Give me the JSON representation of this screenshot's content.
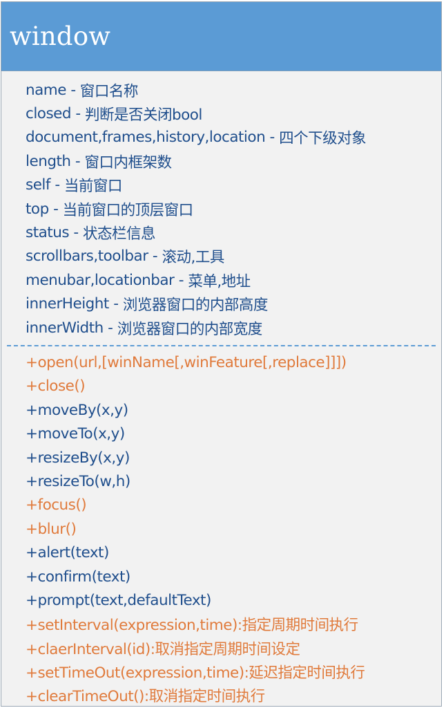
{
  "class_box": {
    "title": "window",
    "attributes": [
      {
        "name": "name",
        "sep": " - ",
        "desc": "窗口名称"
      },
      {
        "name": "closed",
        "sep": " - ",
        "desc": "判断是否关闭bool"
      },
      {
        "name": "document,frames,history,location",
        "sep": " - ",
        "desc": "四个下级对象"
      },
      {
        "name": "length",
        "sep": " - ",
        "desc": "窗口内框架数"
      },
      {
        "name": "self",
        "sep": " - ",
        "desc": "当前窗口"
      },
      {
        "name": "top",
        "sep": " - ",
        "desc": "当前窗口的顶层窗口"
      },
      {
        "name": "status",
        "sep": " - ",
        "desc": "状态栏信息"
      },
      {
        "name": "scrollbars,toolbar",
        "sep": " - ",
        "desc": "滚动,工具"
      },
      {
        "name": "menubar,locationbar",
        "sep": " - ",
        "desc": "菜单,地址"
      },
      {
        "name": "innerHeight",
        "sep": " - ",
        "desc": "浏览器窗口的内部高度"
      },
      {
        "name": "innerWidth",
        "sep": " - ",
        "desc": "浏览器窗口的内部宽度"
      }
    ],
    "operations": [
      {
        "text": "+open(url,[winName[,winFeature[,replace]]])",
        "color": "orange"
      },
      {
        "text": "+close()",
        "color": "orange"
      },
      {
        "text": "+moveBy(x,y)",
        "color": "blue"
      },
      {
        "text": "+moveTo(x,y)",
        "color": "blue"
      },
      {
        "text": "+resizeBy(x,y)",
        "color": "blue"
      },
      {
        "text": "+resizeTo(w,h)",
        "color": "blue"
      },
      {
        "text": "+focus()",
        "color": "orange"
      },
      {
        "text": "+blur()",
        "color": "orange"
      },
      {
        "text": "+alert(text)",
        "color": "blue"
      },
      {
        "text": "+confirm(text)",
        "color": "blue"
      },
      {
        "text": "+prompt(text,defaultText)",
        "color": "blue"
      },
      {
        "text": "+setInterval(expression,time):指定周期时间执行",
        "color": "orange"
      },
      {
        "text": "+claerInterval(id):取消指定周期时间设定",
        "color": "orange"
      },
      {
        "text": "+setTimeOut(expression,time):延迟指定时间执行",
        "color": "orange"
      },
      {
        "text": "+clearTimeOut():取消指定时间执行",
        "color": "orange"
      }
    ]
  },
  "colors": {
    "header_bg": "#5b9bd5",
    "body_bg": "#f2f2f2",
    "attribute_text": "#1f4e8c",
    "operation_blue": "#1f4e8c",
    "operation_orange": "#e07a3b"
  }
}
